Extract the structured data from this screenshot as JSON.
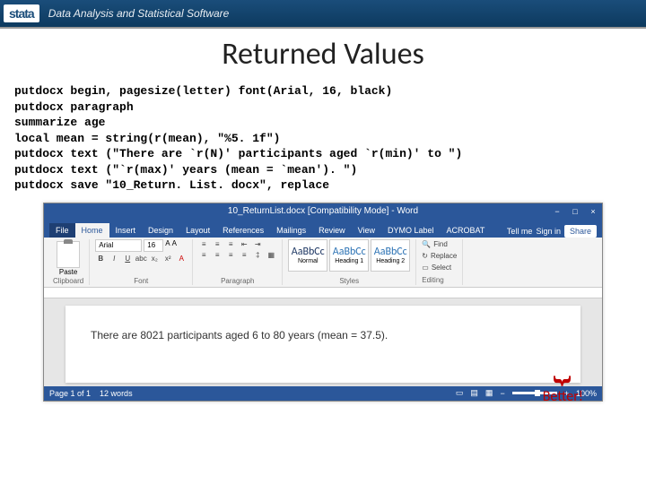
{
  "header": {
    "logo": "stata",
    "tagline": "Data Analysis and Statistical Software"
  },
  "slide": {
    "title": "Returned Values",
    "code": "putdocx begin, pagesize(letter) font(Arial, 16, black)\nputdocx paragraph\nsummarize age\nlocal mean = string(r(mean), \"%5. 1f\")\nputdocx text (\"There are `r(N)' participants aged `r(min)' to \")\nputdocx text (\"`r(max)' years (mean = `mean'). \")\nputdocx save \"10_Return. List. docx\", replace",
    "annotation": "Better!"
  },
  "word": {
    "title": "10_ReturnList.docx [Compatibility Mode] - Word",
    "tabs": [
      "File",
      "Home",
      "Insert",
      "Design",
      "Layout",
      "References",
      "Mailings",
      "Review",
      "View",
      "DYMO Label",
      "ACROBAT"
    ],
    "tell_me": "Tell me",
    "signin": "Sign in",
    "share": "Share",
    "ribbon": {
      "paste": "Paste",
      "clipboard": "Clipboard",
      "font_name": "Arial",
      "font_size": "16",
      "font_label": "Font",
      "para_label": "Paragraph",
      "style_normal": "Normal",
      "style_h1": "Heading 1",
      "style_h2": "Heading 2",
      "styles_label": "Styles",
      "find": "Find",
      "replace": "Replace",
      "select": "Select",
      "editing_label": "Editing"
    },
    "doc_text": "There are 8021 participants aged 6 to 80 years (mean = 37.5).",
    "status": {
      "page": "Page 1 of 1",
      "words": "12 words",
      "zoom": "100%"
    }
  }
}
